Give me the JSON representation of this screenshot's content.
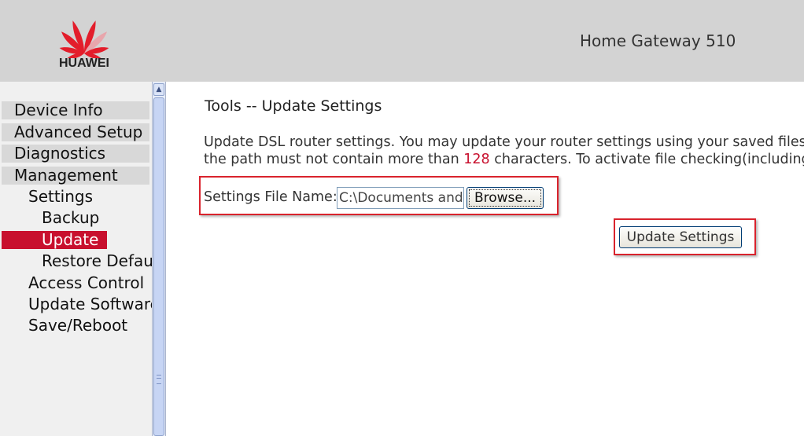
{
  "header": {
    "brand": "HUAWEI",
    "product_title": "Home Gateway 510"
  },
  "sidebar": {
    "items": [
      {
        "label": "Device Info"
      },
      {
        "label": "Advanced Setup"
      },
      {
        "label": "Diagnostics"
      },
      {
        "label": "Management"
      },
      {
        "label": "Settings"
      },
      {
        "label": "Backup"
      },
      {
        "label": "Update"
      },
      {
        "label": "Restore Default"
      },
      {
        "label": "Access Control"
      },
      {
        "label": "Update Software"
      },
      {
        "label": "Save/Reboot"
      }
    ]
  },
  "main": {
    "title": "Tools -- Update Settings",
    "description_line1": "Update DSL router settings. You may update your router settings using your saved files. The",
    "description_line2_before": "the path must not contain more than ",
    "description_line2_number": "128",
    "description_line2_after": " characters. To activate file checking(including ext",
    "file_label": "Settings File Name:",
    "file_value": "C:\\Documents and Settings",
    "browse_label": "Browse...",
    "update_button_label": "Update Settings"
  },
  "colors": {
    "header_bg": "#d3d3d3",
    "brand_red": "#c8102e",
    "highlight_red": "#d9232d"
  }
}
